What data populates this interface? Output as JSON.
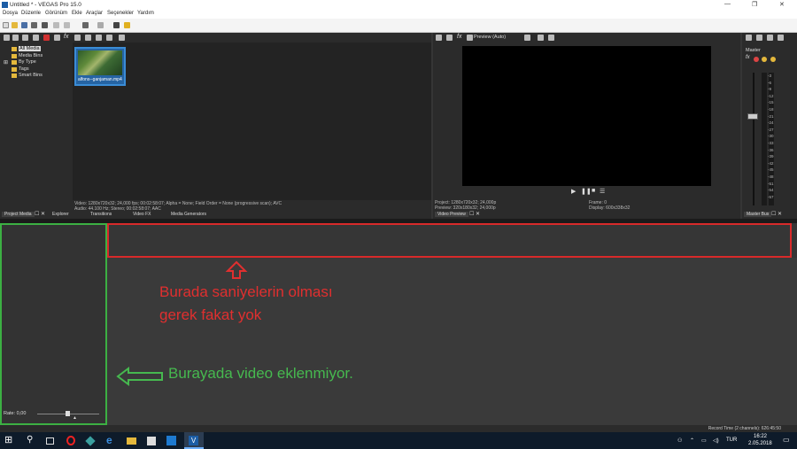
{
  "window": {
    "title": "Untitled * - VEGAS Pro 15.0"
  },
  "menu": [
    "Dosya",
    "Düzenle",
    "Görünüm",
    "Ekle",
    "Araçlar",
    "Seçenekler",
    "Yardım"
  ],
  "project_media": {
    "tree": [
      "All Media",
      "Media Bins",
      "By Type",
      "Tags",
      "Smart Bins"
    ],
    "clip_name": "alfons--ganjaman.mp4",
    "info_video": "Video: 1280x720x32; 24,000 fps; 00:02:58:07; Alpha = None; Field Order = None (progressive scan); AVC",
    "info_audio": "Audio: 44.100 Hz; Stereo; 00:02:58:07; AAC",
    "tabs": [
      "Project Media",
      "Explorer",
      "Transitions",
      "Video FX",
      "Media Generators"
    ]
  },
  "video_preview": {
    "mode": "Preview (Auto)",
    "project": "Project: 1280x720x32; 24,000p",
    "preview": "Preview: 320x180x32; 24,000p",
    "frame": "Frame: 0",
    "display": "Display: 600x338x32",
    "tab": "Video Preview"
  },
  "master_bus": {
    "label": "Master",
    "tab": "Master Bus",
    "scale": [
      "-3",
      "-6",
      "-9",
      "-12",
      "-15",
      "-18",
      "-21",
      "-24",
      "-27",
      "-30",
      "-33",
      "-36",
      "-39",
      "-42",
      "-45",
      "-48",
      "-51",
      "-54",
      "-57"
    ]
  },
  "timeline": {
    "rate": "Rate: 0,00"
  },
  "annotations": {
    "red_line1": "Burada saniyelerin olması",
    "red_line2": "gerek fakat yok",
    "green": "Burayada video eklenmiyor."
  },
  "status": {
    "record_time": "Record Time (2 channels): 626:45:50"
  },
  "taskbar": {
    "lang": "TUR",
    "time": "16:22",
    "date": "2.05.2018"
  }
}
